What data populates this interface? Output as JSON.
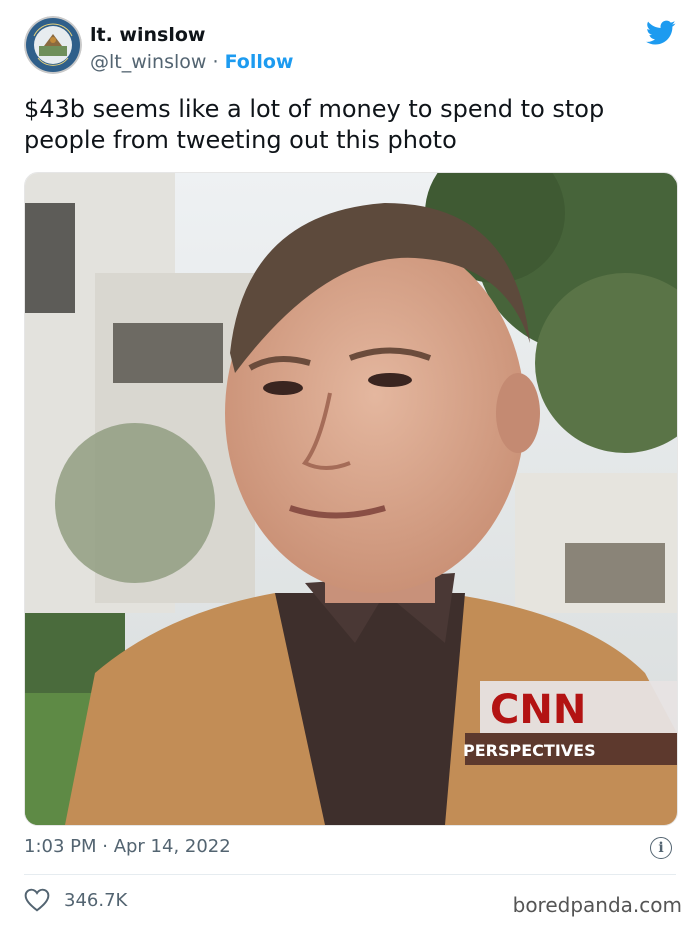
{
  "tweet": {
    "author_name": "lt. winslow",
    "handle": "@lt_winslow",
    "separator": "·",
    "follow_label": "Follow",
    "text": "$43b seems like a lot of money to spend to stop people from tweeting out this photo",
    "timestamp": "1:03 PM · Apr 14, 2022",
    "likes": "346.7K",
    "info_glyph": "i"
  },
  "avatar": {
    "seal_text_top": "SEAL OF EL DORADO",
    "seal_text_bottom": "FLORIDA"
  },
  "media": {
    "overlay_logo": "CNN",
    "overlay_caption": "PERSPECTIVES"
  },
  "watermark": "boredpanda.com",
  "colors": {
    "accent": "#1d9bf0",
    "secondary_text": "#536471",
    "primary_text": "#0f1419"
  },
  "icons": {
    "bird": "twitter-bird-icon",
    "heart": "heart-icon",
    "info": "info-icon"
  }
}
